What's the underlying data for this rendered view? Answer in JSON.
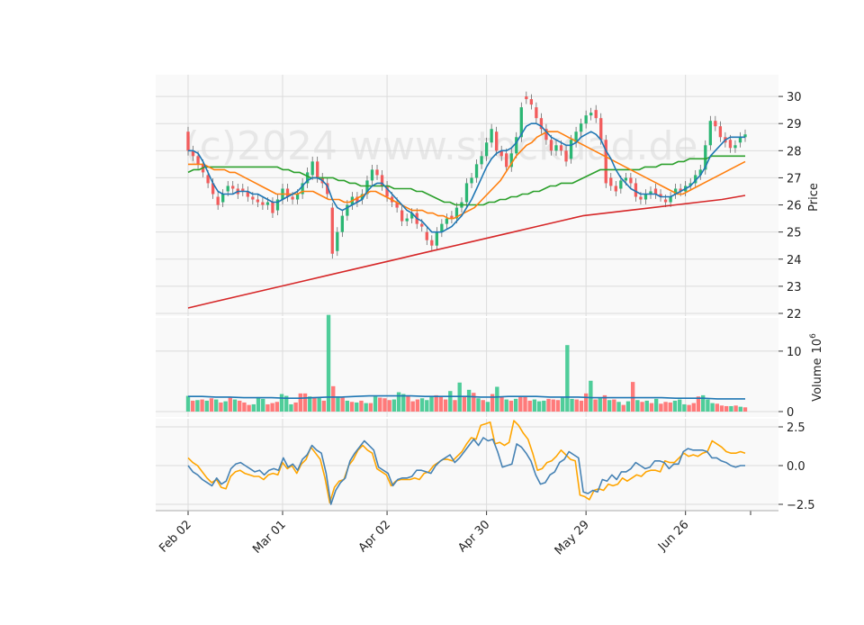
{
  "chart_data": {
    "type": "candlestick",
    "watermark": "(c)2024 www.stockdad.de",
    "x_tick_labels": [
      "Feb 02",
      "Mar 01",
      "Apr 02",
      "Apr 30",
      "May 29",
      "Jun 26"
    ],
    "x_tick_index": [
      0,
      19,
      40,
      60,
      80,
      100
    ],
    "price_panel": {
      "ylabel": "Price",
      "ylim": [
        21.9,
        30.8
      ],
      "ticks": [
        22,
        23,
        24,
        25,
        26,
        27,
        28,
        29,
        30
      ]
    },
    "volume_panel": {
      "ylabel": "Volume",
      "ylabel_exponent": "10^6",
      "ylim": [
        0,
        15.5
      ],
      "ticks": [
        0,
        10
      ]
    },
    "indicator_panel": {
      "ylim": [
        -2.8,
        2.8
      ],
      "ticks": [
        -2.5,
        0.0,
        2.5
      ],
      "tick_labels": [
        "−2.5",
        "0.0",
        "2.5"
      ]
    },
    "colors": {
      "up": "#2bb673",
      "down": "#f25c5c",
      "ma_fast": "#1f77b4",
      "ma_mid": "#ff7f0e",
      "ma_slow": "#2ca02c",
      "ma_long": "#d62728",
      "vol_ma": "#1f77b4",
      "osc_a": "#4682b4",
      "osc_b": "#ffa500"
    },
    "closes": [
      28.0,
      27.8,
      27.5,
      27.2,
      26.8,
      26.4,
      26.0,
      26.4,
      26.7,
      26.6,
      26.4,
      26.5,
      26.3,
      26.2,
      26.1,
      26.0,
      26.1,
      25.7,
      26.2,
      26.6,
      26.3,
      26.2,
      26.4,
      26.8,
      27.2,
      27.6,
      27.0,
      26.8,
      26.4,
      24.2,
      25.0,
      25.6,
      26.0,
      26.3,
      26.1,
      26.4,
      26.9,
      27.3,
      27.1,
      26.7,
      26.3,
      26.1,
      25.9,
      25.4,
      25.5,
      25.7,
      25.3,
      25.2,
      24.7,
      24.5,
      25.0,
      25.3,
      25.5,
      25.5,
      25.9,
      26.1,
      26.8,
      27.0,
      27.5,
      27.8,
      28.3,
      28.8,
      28.0,
      27.8,
      27.4,
      27.9,
      28.5,
      29.6,
      29.9,
      29.7,
      29.2,
      28.8,
      28.4,
      28.0,
      28.2,
      28.0,
      27.6,
      28.4,
      28.7,
      29.0,
      29.3,
      29.4,
      29.2,
      28.4,
      26.8,
      26.7,
      26.5,
      26.9,
      27.0,
      26.8,
      26.3,
      26.2,
      26.4,
      26.5,
      26.4,
      26.3,
      26.1,
      26.3,
      26.6,
      26.5,
      26.7,
      26.8,
      27.1,
      27.3,
      28.2,
      29.1,
      28.9,
      28.5,
      28.3,
      28.1,
      28.2,
      28.5,
      28.6
    ],
    "opens": [
      28.7,
      28.0,
      27.8,
      27.5,
      27.1,
      26.8,
      26.3,
      26.1,
      26.5,
      26.7,
      26.6,
      26.6,
      26.5,
      26.3,
      26.2,
      26.1,
      26.0,
      26.1,
      25.8,
      26.2,
      26.6,
      26.3,
      26.2,
      26.4,
      26.8,
      27.1,
      27.6,
      27.0,
      26.8,
      25.9,
      24.3,
      25.0,
      25.6,
      26.0,
      26.3,
      26.2,
      26.4,
      26.9,
      27.3,
      27.1,
      26.7,
      26.3,
      26.1,
      25.8,
      25.4,
      25.5,
      25.7,
      25.3,
      25.0,
      24.7,
      24.5,
      25.0,
      25.3,
      25.6,
      25.5,
      25.9,
      26.1,
      26.8,
      27.0,
      27.5,
      27.8,
      28.3,
      28.7,
      28.0,
      27.9,
      27.4,
      27.9,
      28.5,
      30.0,
      29.9,
      29.6,
      29.2,
      28.8,
      28.4,
      28.0,
      28.2,
      28.0,
      27.7,
      28.3,
      28.7,
      29.0,
      29.3,
      29.5,
      29.2,
      28.4,
      27.0,
      26.7,
      26.6,
      26.9,
      27.0,
      26.8,
      26.3,
      26.2,
      26.4,
      26.6,
      26.4,
      26.2,
      26.1,
      26.4,
      26.6,
      26.5,
      26.7,
      26.8,
      27.1,
      27.3,
      28.2,
      29.1,
      28.9,
      28.5,
      28.4,
      28.1,
      28.3,
      28.5
    ],
    "ma_fast": [
      28.0,
      28.0,
      27.9,
      27.6,
      27.2,
      26.8,
      26.5,
      26.4,
      26.4,
      26.4,
      26.5,
      26.5,
      26.5,
      26.4,
      26.4,
      26.3,
      26.2,
      26.1,
      26.1,
      26.2,
      26.3,
      26.4,
      26.5,
      26.7,
      26.9,
      27.0,
      27.0,
      26.9,
      26.7,
      26.2,
      25.9,
      25.8,
      25.9,
      26.0,
      26.1,
      26.2,
      26.5,
      26.7,
      26.8,
      26.8,
      26.6,
      26.4,
      26.2,
      26.0,
      25.8,
      25.7,
      25.5,
      25.4,
      25.2,
      25.0,
      25.0,
      25.0,
      25.1,
      25.2,
      25.4,
      25.6,
      25.9,
      26.2,
      26.6,
      27.0,
      27.4,
      27.7,
      27.9,
      28.0,
      28.0,
      28.1,
      28.3,
      28.6,
      28.9,
      29.0,
      29.0,
      28.9,
      28.7,
      28.5,
      28.4,
      28.3,
      28.2,
      28.2,
      28.3,
      28.5,
      28.6,
      28.7,
      28.6,
      28.4,
      28.0,
      27.7,
      27.3,
      27.0,
      26.8,
      26.6,
      26.5,
      26.4,
      26.4,
      26.4,
      26.4,
      26.3,
      26.3,
      26.3,
      26.4,
      26.5,
      26.6,
      26.7,
      26.9,
      27.1,
      27.4,
      27.8,
      28.0,
      28.2,
      28.4,
      28.5,
      28.5,
      28.5,
      28.5
    ],
    "ma_mid": [
      27.5,
      27.5,
      27.5,
      27.5,
      27.4,
      27.3,
      27.3,
      27.3,
      27.2,
      27.2,
      27.1,
      27.0,
      26.9,
      26.8,
      26.7,
      26.6,
      26.5,
      26.4,
      26.4,
      26.4,
      26.4,
      26.4,
      26.5,
      26.5,
      26.5,
      26.4,
      26.3,
      26.2,
      26.2,
      26.2,
      26.1,
      26.1,
      26.2,
      26.3,
      26.4,
      26.5,
      26.5,
      26.4,
      26.3,
      26.2,
      26.1,
      26.0,
      25.9,
      25.8,
      25.8,
      25.8,
      25.7,
      25.7,
      25.6,
      25.6,
      25.5,
      25.5,
      25.6,
      25.7,
      25.8,
      25.9,
      26.1,
      26.3,
      26.5,
      26.7,
      26.9,
      27.2,
      27.5,
      27.8,
      28.0,
      28.2,
      28.3,
      28.5,
      28.6,
      28.7,
      28.7,
      28.7,
      28.6,
      28.5,
      28.4,
      28.3,
      28.2,
      28.1,
      28.0,
      27.9,
      27.8,
      27.7,
      27.6,
      27.5,
      27.4,
      27.3,
      27.2,
      27.1,
      27.0,
      26.9,
      26.8,
      26.7,
      26.6,
      26.5,
      26.4,
      26.4,
      26.5,
      26.6,
      26.7,
      26.8,
      26.9,
      27.0,
      27.1,
      27.2,
      27.3,
      27.4,
      27.5,
      27.6
    ],
    "ma_slow": [
      27.2,
      27.3,
      27.3,
      27.4,
      27.4,
      27.4,
      27.4,
      27.4,
      27.4,
      27.4,
      27.4,
      27.4,
      27.4,
      27.4,
      27.4,
      27.4,
      27.4,
      27.3,
      27.3,
      27.2,
      27.2,
      27.1,
      27.0,
      27.0,
      27.0,
      27.0,
      27.0,
      26.9,
      26.9,
      26.8,
      26.8,
      26.7,
      26.7,
      26.7,
      26.7,
      26.7,
      26.7,
      26.6,
      26.6,
      26.6,
      26.6,
      26.5,
      26.5,
      26.4,
      26.3,
      26.2,
      26.1,
      26.1,
      26.0,
      26.0,
      26.0,
      26.0,
      26.0,
      26.0,
      26.1,
      26.1,
      26.2,
      26.2,
      26.3,
      26.3,
      26.4,
      26.4,
      26.5,
      26.5,
      26.6,
      26.7,
      26.7,
      26.8,
      26.8,
      26.8,
      26.9,
      27.0,
      27.1,
      27.2,
      27.3,
      27.3,
      27.3,
      27.3,
      27.3,
      27.3,
      27.3,
      27.3,
      27.4,
      27.4,
      27.4,
      27.5,
      27.5,
      27.5,
      27.6,
      27.6,
      27.7,
      27.7,
      27.7,
      27.7,
      27.8,
      27.8,
      27.8,
      27.8,
      27.8,
      27.8,
      27.8
    ],
    "ma_long": [
      22.2,
      22.4,
      22.6,
      22.8,
      23.0,
      23.2,
      23.4,
      23.6,
      23.8,
      24.0,
      24.2,
      24.4,
      24.6,
      24.8,
      25.0,
      25.2,
      25.4,
      25.6,
      25.7,
      25.8,
      25.9,
      26.0,
      26.1,
      26.2,
      26.35
    ],
    "volumes": [
      2.6,
      1.8,
      1.9,
      2.0,
      1.8,
      2.2,
      2.0,
      1.5,
      1.7,
      2.3,
      2.0,
      1.8,
      1.5,
      1.1,
      1.2,
      2.4,
      2.1,
      1.2,
      1.4,
      1.6,
      2.9,
      2.6,
      1.2,
      1.5,
      3.0,
      3.0,
      2.5,
      2.4,
      2.3,
      1.8,
      16.0,
      4.2,
      2.5,
      2.3,
      1.8,
      1.6,
      1.5,
      1.8,
      1.4,
      1.4,
      2.5,
      2.3,
      2.2,
      1.9,
      2.0,
      3.2,
      2.9,
      2.6,
      1.7,
      2.0,
      2.2,
      1.9,
      2.5,
      2.7,
      2.6,
      2.0,
      3.4,
      1.9,
      4.8,
      2.5,
      3.6,
      3.1,
      2.2,
      1.9,
      1.6,
      2.9,
      4.1,
      2.4,
      2.0,
      1.8,
      2.1,
      2.5,
      2.6,
      1.8,
      2.0,
      1.7,
      1.8,
      2.1,
      2.0,
      1.9,
      2.3,
      11.0,
      2.1,
      2.0,
      1.8,
      3.0,
      5.1,
      2.0,
      2.2,
      2.7,
      1.9,
      2.0,
      1.6,
      1.1,
      1.7,
      4.9,
      1.9,
      1.6,
      1.8,
      1.4,
      2.1,
      1.3,
      1.6,
      1.5,
      1.8,
      2.0,
      1.2,
      1.1,
      1.4,
      2.5,
      2.7,
      2.0,
      1.4,
      1.3,
      1.0,
      0.9,
      0.9,
      1.0,
      0.8,
      0.7
    ],
    "vol_ma": [
      2.5,
      2.5,
      2.4,
      2.4,
      2.3,
      2.3,
      2.3,
      2.2,
      2.2,
      2.3,
      2.4,
      2.4,
      2.5,
      2.6,
      2.6,
      2.6,
      2.6,
      2.5,
      2.5,
      2.5,
      2.5,
      2.4,
      2.4,
      2.5,
      2.5,
      2.5,
      2.4,
      2.4,
      2.4,
      2.3,
      2.3,
      2.3,
      2.3,
      2.3,
      2.3,
      2.2,
      2.2,
      2.2,
      2.1,
      2.1,
      2.1
    ],
    "osc_a": [
      0.0,
      -0.4,
      -0.6,
      -0.9,
      -1.1,
      -1.3,
      -0.8,
      -1.2,
      -1.0,
      -0.2,
      0.1,
      0.2,
      0.0,
      -0.2,
      -0.4,
      -0.3,
      -0.6,
      -0.3,
      -0.2,
      -0.3,
      0.5,
      -0.1,
      0.1,
      -0.3,
      0.4,
      0.7,
      1.3,
      1.0,
      0.8,
      -0.5,
      -2.5,
      -1.6,
      -1.1,
      -0.8,
      0.3,
      0.8,
      1.2,
      1.6,
      1.3,
      1.0,
      -0.1,
      -0.3,
      -0.5,
      -1.3,
      -0.9,
      -0.8,
      -0.8,
      -0.7,
      -0.3,
      -0.3,
      -0.4,
      -0.5,
      0.0,
      0.3,
      0.5,
      0.7,
      0.2,
      0.5,
      0.9,
      1.3,
      1.7,
      1.3,
      1.8,
      1.6,
      1.7,
      0.9,
      -0.1,
      0.0,
      0.1,
      1.4,
      1.2,
      0.8,
      0.3,
      -0.6,
      -1.2,
      -1.1,
      -0.6,
      -0.4,
      0.2,
      0.4,
      0.9,
      0.7,
      0.5,
      -1.7,
      -1.8,
      -1.6,
      -1.7,
      -0.9,
      -1.0,
      -0.6,
      -0.9,
      -0.4,
      -0.4,
      -0.2,
      0.2,
      0.0,
      -0.2,
      -0.1,
      0.3,
      0.3,
      0.2,
      -0.2,
      0.1,
      0.1,
      0.9,
      1.1,
      1.0,
      1.0,
      1.0,
      0.9,
      0.5,
      0.5,
      0.3,
      0.2,
      0.0,
      -0.1,
      0.0,
      0.0
    ],
    "osc_b": [
      0.5,
      0.2,
      0.0,
      -0.4,
      -0.8,
      -1.1,
      -0.9,
      -1.4,
      -1.5,
      -0.7,
      -0.4,
      -0.3,
      -0.5,
      -0.6,
      -0.7,
      -0.7,
      -0.9,
      -0.6,
      -0.5,
      -0.6,
      0.2,
      -0.2,
      0.0,
      -0.5,
      0.1,
      0.4,
      1.2,
      0.8,
      0.4,
      -0.8,
      -2.4,
      -1.4,
      -1.0,
      -0.9,
      0.0,
      0.4,
      1.0,
      1.3,
      1.0,
      0.8,
      -0.2,
      -0.4,
      -0.6,
      -1.3,
      -1.0,
      -0.9,
      -0.9,
      -0.9,
      -0.8,
      -0.9,
      -0.5,
      -0.4,
      0.0,
      0.2,
      0.4,
      0.4,
      0.3,
      0.6,
      0.9,
      1.4,
      1.8,
      1.7,
      2.6,
      2.7,
      2.8,
      1.4,
      1.5,
      1.3,
      1.5,
      2.9,
      2.6,
      2.1,
      1.7,
      0.8,
      -0.3,
      -0.2,
      0.2,
      0.3,
      0.6,
      1.0,
      0.7,
      0.4,
      0.3,
      -1.9,
      -2.0,
      -2.2,
      -1.6,
      -1.5,
      -1.6,
      -1.2,
      -1.3,
      -1.2,
      -0.8,
      -1.0,
      -0.8,
      -0.6,
      -0.7,
      -0.4,
      -0.3,
      -0.3,
      -0.4,
      0.3,
      0.2,
      0.2,
      0.5,
      0.8,
      0.6,
      0.7,
      0.6,
      0.8,
      0.9,
      1.6,
      1.4,
      1.2,
      0.9,
      0.8,
      0.8,
      0.9,
      0.8
    ]
  }
}
